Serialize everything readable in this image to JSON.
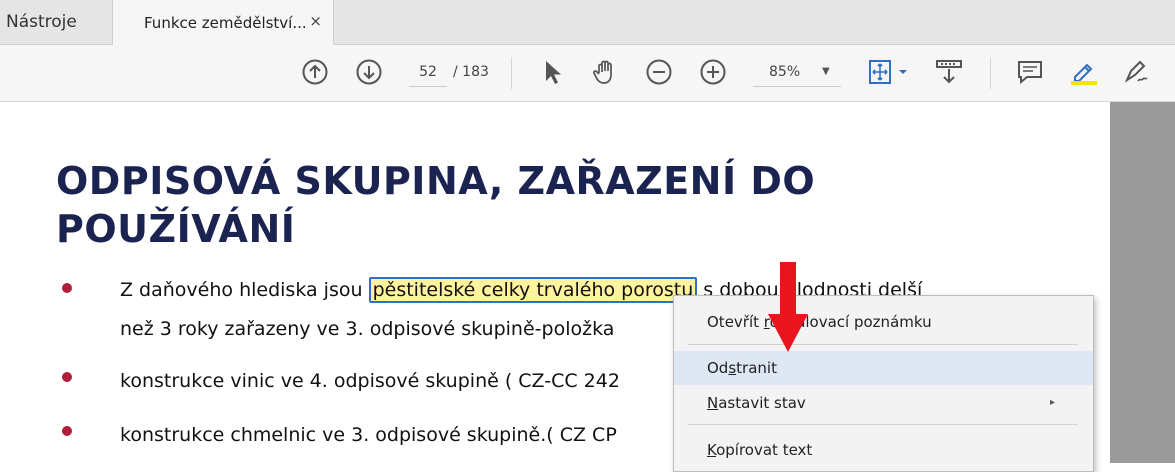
{
  "tabs": {
    "tools_label": "Nástroje",
    "doc_title": "Funkce zemědělství...",
    "close_glyph": "×"
  },
  "toolbar": {
    "page_current": "52",
    "page_total": "/ 183",
    "zoom": "85%",
    "zoom_arrow": "▼",
    "icons": [
      "prev-page-icon",
      "next-page-icon",
      "select-cursor-icon",
      "hand-tool-icon",
      "zoom-out-icon",
      "zoom-in-icon",
      "fit-page-icon",
      "read-mode-icon",
      "comment-icon",
      "highlight-icon",
      "sign-icon"
    ]
  },
  "document": {
    "heading_line1": "ODPISOVÁ SKUPINA, ZAŘAZENÍ DO",
    "heading_line2": "POUŽÍVÁNÍ",
    "bullet1_pre": "Z daňového hlediska jsou ",
    "bullet1_highlight": "pěstitelské celky trvalého porostu",
    "bullet1_post": " s dobou plodnosti delší",
    "bullet1_line2": "než 3 roky zařazeny ve 3. odpisové skupině-položka",
    "bullet2": "konstrukce vinic ve 4. odpisové skupině ( CZ-CC 242",
    "bullet3": "konstrukce chmelnic ve 3. odpisové skupině.( CZ CP"
  },
  "context_menu": {
    "items": [
      {
        "label": "Otevřít rozbalovací poznámku",
        "underline_char": "r"
      },
      {
        "label": "Odstranit",
        "underline_char": "s"
      },
      {
        "label": "Nastavit stav",
        "underline_char": "N",
        "has_submenu": true
      },
      {
        "label": "Kopírovat text",
        "underline_char": "K"
      }
    ],
    "submenu_arrow": "▸"
  },
  "colors": {
    "heading": "#1b2350",
    "bullet": "#b01e3c",
    "highlight_fill": "#fff3a0",
    "highlight_border": "#2e6fcf",
    "annotation_arrow": "#e8141e",
    "menu_hover": "#dde8f4"
  }
}
